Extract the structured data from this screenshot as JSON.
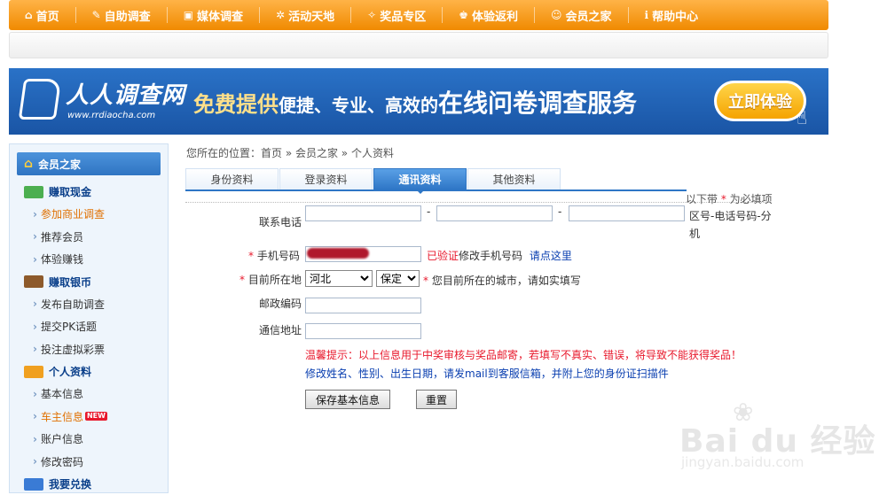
{
  "nav": {
    "items": [
      {
        "label": "首页",
        "icon": "home-icon",
        "glyph": "⌂"
      },
      {
        "label": "自助调查",
        "icon": "pen-icon",
        "glyph": "✎"
      },
      {
        "label": "媒体调查",
        "icon": "media-icon",
        "glyph": "▣"
      },
      {
        "label": "活动天地",
        "icon": "activity-icon",
        "glyph": "✲"
      },
      {
        "label": "奖品专区",
        "icon": "prize-icon",
        "glyph": "✧"
      },
      {
        "label": "体验返利",
        "icon": "gift-icon",
        "glyph": "♚"
      },
      {
        "label": "会员之家",
        "icon": "member-icon",
        "glyph": "☺"
      },
      {
        "label": "帮助中心",
        "icon": "help-icon",
        "glyph": "ℹ"
      }
    ]
  },
  "banner": {
    "logo_text": "人人调查网",
    "logo_url": "www.rrdiaocha.com",
    "slogan_a": "免费提供",
    "slogan_b": "便捷、专业、高效的",
    "slogan_c": "在线问卷调查服务",
    "try_button": "立即体验"
  },
  "sidebar": {
    "header": "会员之家",
    "sections": [
      {
        "title": "赚取现金",
        "items": [
          {
            "label": "参加商业调查",
            "active": true
          },
          {
            "label": "推荐会员",
            "active": false
          },
          {
            "label": "体验赚钱",
            "active": false
          }
        ]
      },
      {
        "title": "赚取银币",
        "items": [
          {
            "label": "发布自助调查",
            "active": false
          },
          {
            "label": "提交PK话题",
            "active": false
          },
          {
            "label": "投注虚拟彩票",
            "active": false
          }
        ]
      },
      {
        "title": "个人资料",
        "items": [
          {
            "label": "基本信息",
            "active": false
          },
          {
            "label": "车主信息",
            "active": true,
            "badge": "NEW"
          },
          {
            "label": "账户信息",
            "active": false
          },
          {
            "label": "修改密码",
            "active": false
          }
        ]
      },
      {
        "title": "我要兑换",
        "items": []
      }
    ]
  },
  "breadcrumb": "您所在的位置：首页 » 会员之家 » 个人资料",
  "tabs": [
    {
      "label": "身份资料",
      "active": false
    },
    {
      "label": "登录资料",
      "active": false
    },
    {
      "label": "通讯资料",
      "active": true
    },
    {
      "label": "其他资料",
      "active": false
    }
  ],
  "form": {
    "required_note_prefix": "以下带",
    "required_note_star": "*",
    "required_note_suffix": "为必填项",
    "phone_label": "联系电话",
    "phone_hint": "区号-电话号码-分机",
    "mobile_label": "手机号码",
    "verified": "已验证",
    "change_mobile": "修改手机号码",
    "click_here": "请点这里",
    "location_label": "目前所在地",
    "province": "河北",
    "city": "保定",
    "location_hint": "您目前所在的城市，请如实填写",
    "zip_label": "邮政编码",
    "address_label": "通信地址",
    "warning": "温馨提示：以上信息用于中奖审核与奖品邮寄，若填写不真实、错误，将导致不能获得奖品！",
    "info": "修改姓名、性别、出生日期，请发mail到客服信箱，并附上您的身份证扫描件",
    "save_button": "保存基本信息",
    "reset_button": "重置"
  },
  "watermark": {
    "main": "Bai du 经验",
    "url": "jingyan.baidu.com"
  },
  "colors": {
    "nav_orange": "#f08a00",
    "banner_blue": "#1a55a5",
    "required_red": "#e8192c",
    "link_blue": "#0a3fb0"
  }
}
